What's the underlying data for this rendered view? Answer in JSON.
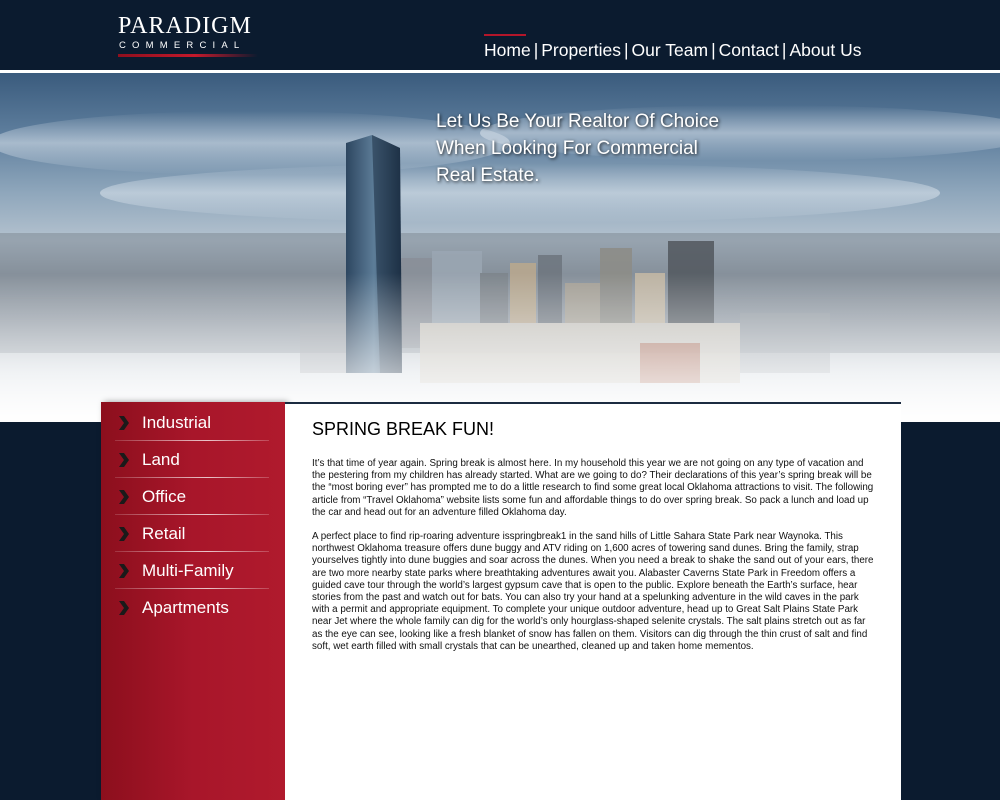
{
  "logo": {
    "main": "PARADIGM",
    "sub": "COMMERCIAL"
  },
  "nav": {
    "items": [
      "Home",
      "Properties",
      "Our Team",
      "Contact",
      "About Us"
    ],
    "separator": "|"
  },
  "hero": {
    "tagline_lines": [
      "Let Us Be Your Realtor Of Choice",
      "When Looking For Commercial",
      "Real Estate."
    ]
  },
  "sidebar": {
    "items": [
      "Industrial",
      "Land",
      "Office",
      "Retail",
      "Multi-Family",
      "Apartments"
    ],
    "icon": "chevron-right-icon"
  },
  "article": {
    "title": "SPRING BREAK FUN!",
    "paragraphs": [
      "It’s that time of year again. Spring break is almost here.  In my household this year we are not going on any type of vacation and the pestering from my children has already started. What are we going to do?   Their declarations of this year’s spring break will be the “most boring ever” has prompted me to do a little research to find some great local Oklahoma attractions to visit.  The following article from “Travel Oklahoma” website lists some fun and affordable things to do over spring break.   So pack a lunch and load up the car and head out for an adventure filled Oklahoma day.",
      "A perfect place to find rip-roaring adventure isspringbreak1 in the sand hills of Little Sahara State Park near Waynoka. This northwest Oklahoma treasure offers dune buggy and ATV riding on 1,600 acres of towering sand dunes.  Bring the family, strap yourselves tightly into dune buggies and soar across the dunes.  When you need a break to shake the sand out of your ears, there are two more nearby state parks where breathtaking adventures await you.  Alabaster Caverns State Park in Freedom offers a guided cave tour through the world’s largest gypsum cave that is open to the public.  Explore beneath the Earth’s surface, hear stories from the past and watch out for bats.  You can also try your hand at a spelunking adventure in the wild caves in the park with a permit and appropriate equipment.  To complete your unique outdoor adventure, head up to Great Salt Plains State Park near Jet where the whole family can dig for the world’s only hourglass-shaped selenite crystals.  The salt plains stretch out as far as the eye can see, looking like a fresh blanket of snow has fallen on them.  Visitors can dig through the thin crust of salt and find soft, wet earth filled with small crystals that can be unearthed, cleaned up and taken home mementos."
    ]
  },
  "colors": {
    "header_bg": "#0b1b2f",
    "accent_red": "#b3162a",
    "sidebar_red": "#a8162a",
    "content_bg": "#ffffff"
  }
}
